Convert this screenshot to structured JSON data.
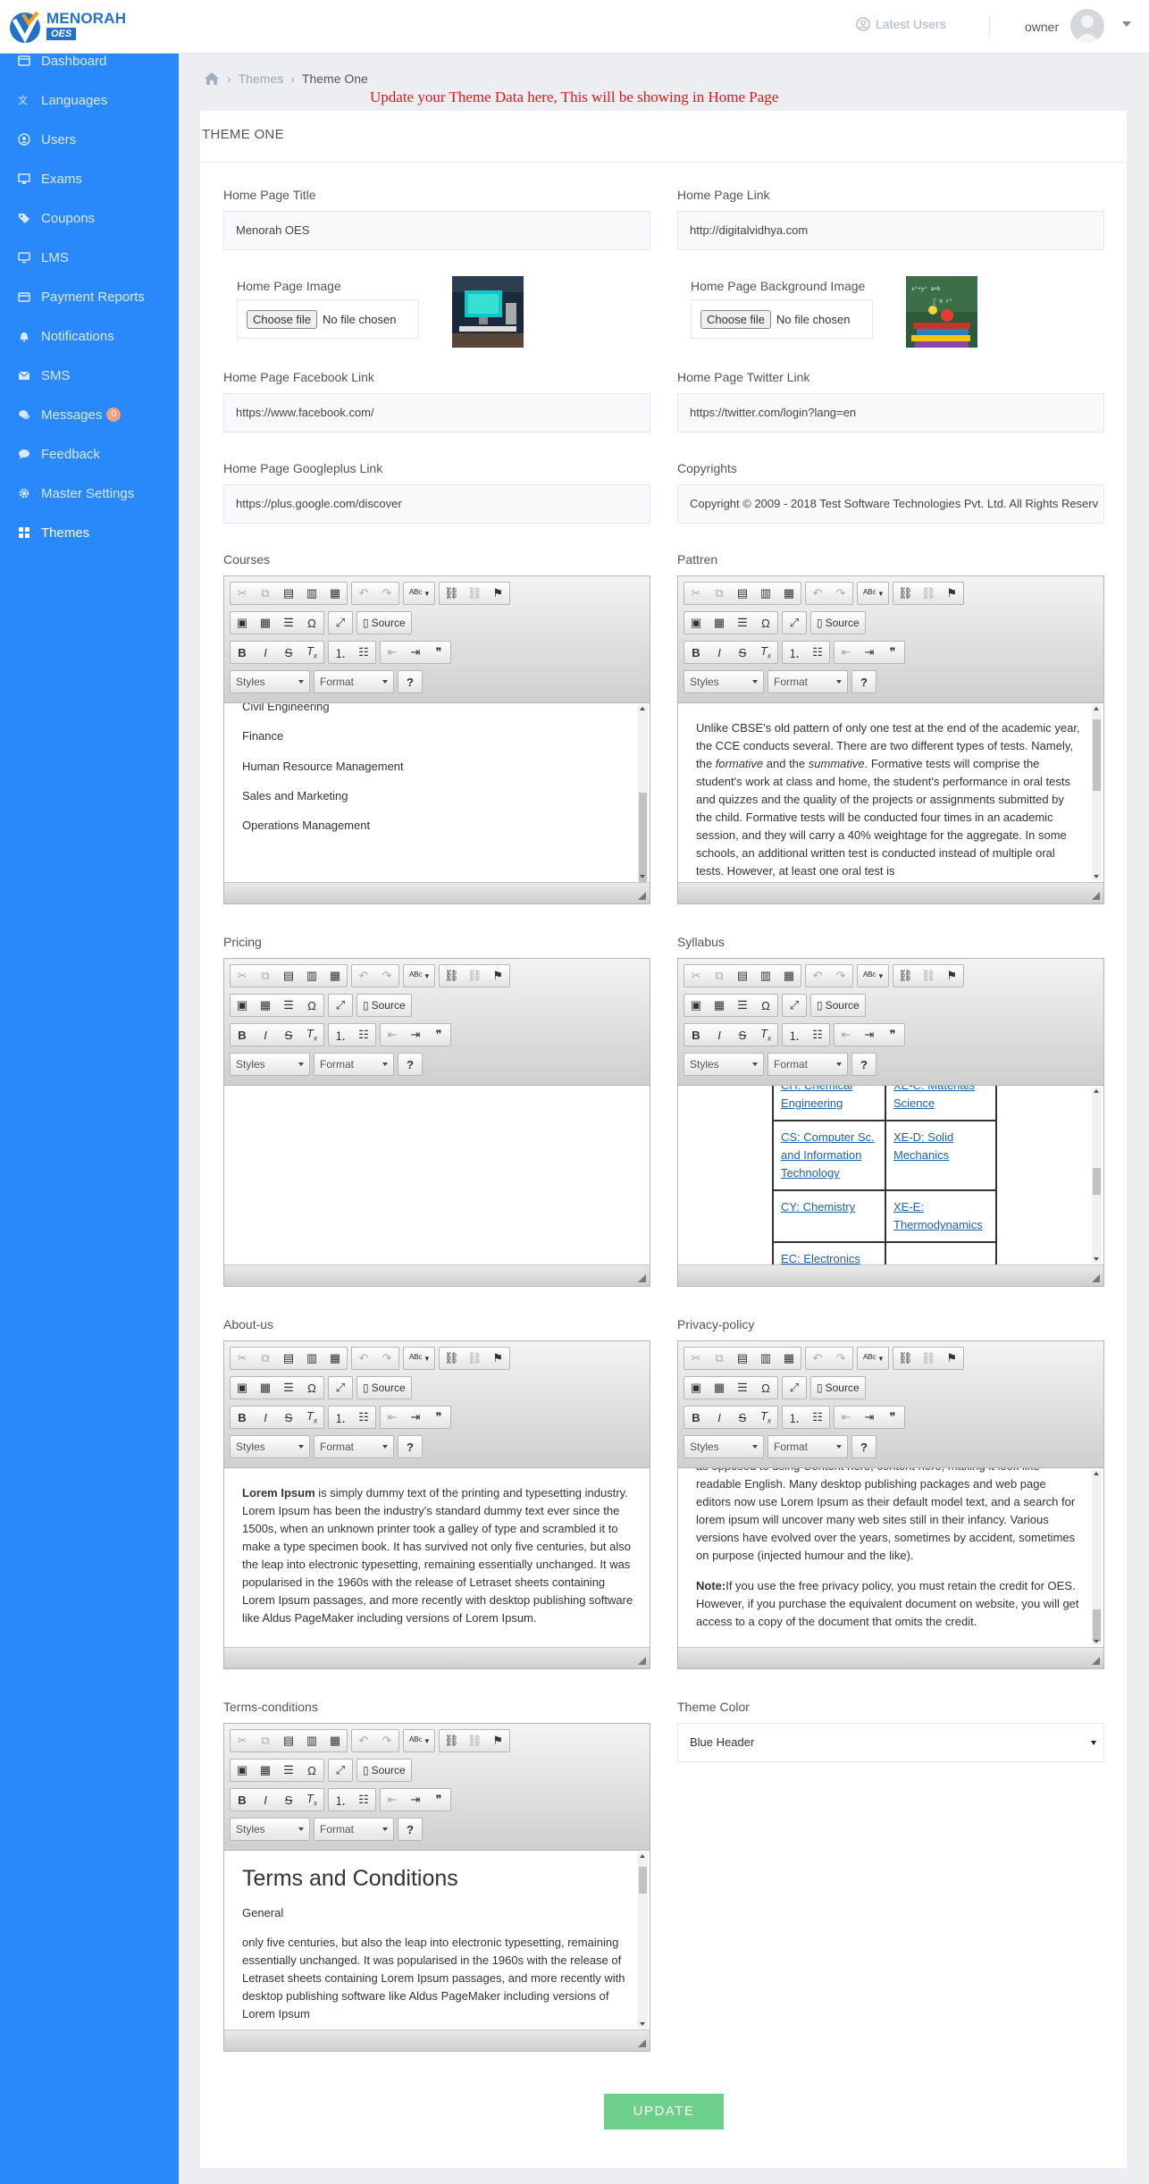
{
  "header": {
    "brand_name": "MENORAH",
    "brand_sub": "OES",
    "latest_users": "Latest Users",
    "user_name": "owner"
  },
  "sidebar": {
    "items": [
      {
        "label": "Dashboard",
        "icon": "dashboard-icon"
      },
      {
        "label": "Languages",
        "icon": "language-icon"
      },
      {
        "label": "Users",
        "icon": "user-icon"
      },
      {
        "label": "Exams",
        "icon": "desktop-icon"
      },
      {
        "label": "Coupons",
        "icon": "tags-icon"
      },
      {
        "label": "LMS",
        "icon": "monitor-icon"
      },
      {
        "label": "Payment Reports",
        "icon": "credit-card-icon"
      },
      {
        "label": "Notifications",
        "icon": "bell-icon"
      },
      {
        "label": "SMS",
        "icon": "envelope-icon"
      },
      {
        "label": "Messages",
        "icon": "comments-icon",
        "badge": "0"
      },
      {
        "label": "Feedback",
        "icon": "comment-icon"
      },
      {
        "label": "Master Settings",
        "icon": "gear-icon"
      },
      {
        "label": "Themes",
        "icon": "grid-icon",
        "active": true
      }
    ]
  },
  "breadcrumb": {
    "items": [
      "Themes",
      "Theme One"
    ]
  },
  "notice": "Update your Theme Data here, This will be showing in Home Page",
  "card": {
    "title": "THEME ONE"
  },
  "form": {
    "home_page_title": {
      "label": "Home Page Title",
      "value": "Menorah OES"
    },
    "home_page_link": {
      "label": "Home Page Link",
      "value": "http://digitalvidhya.com"
    },
    "home_page_image": {
      "label": "Home Page Image",
      "button": "Choose file",
      "status": "No file chosen"
    },
    "home_page_bg_image": {
      "label": "Home Page Background Image",
      "button": "Choose file",
      "status": "No file chosen"
    },
    "facebook": {
      "label": "Home Page Facebook Link",
      "value": "https://www.facebook.com/"
    },
    "twitter": {
      "label": "Home Page Twitter Link",
      "value": "https://twitter.com/login?lang=en"
    },
    "googleplus": {
      "label": "Home Page Googleplus Link",
      "value": "https://plus.google.com/discover"
    },
    "copyrights": {
      "label": "Copyrights",
      "value": "Copyright © 2009 - 2018  Test Software Technologies Pvt. Ltd. All Rights Reserv"
    },
    "theme_color": {
      "label": "Theme Color",
      "value": "Blue Header"
    }
  },
  "editor_toolbar": {
    "source": "Source",
    "styles": "Styles",
    "format": "Format",
    "help": "?"
  },
  "editors": {
    "courses": {
      "label": "Courses",
      "items": [
        "Civil Engineering",
        "Finance",
        "Human Resource Management",
        "Sales and Marketing",
        "Operations Management"
      ]
    },
    "pattren": {
      "label": "Pattren",
      "p1": "Unlike CBSE's old pattern of only one test at the end of the academic year, the CCE conducts several. There are two different types of tests. Namely, the ",
      "p1_em1": "formative",
      "p1_mid": " and the ",
      "p1_em2": "summative",
      "p1_end": ". Formative tests will comprise the student's work at class and home, the student's performance in oral tests and quizzes and the quality of the projects or assignments submitted by the child. Formative tests will be conducted four times in an academic session, and they will carry a 40% weightage for the aggregate. In some schools, an additional written test is conducted instead of multiple oral tests. However, at least one oral test is"
    },
    "pricing": {
      "label": "Pricing"
    },
    "syllabus": {
      "label": "Syllabus",
      "rows": [
        [
          "CH: Chemical Engineering",
          "XE-C: Materials Science"
        ],
        [
          "CS: Computer Sc. and Information Technology",
          "XE-D: Solid Mechanics"
        ],
        [
          "CY: Chemistry",
          "XE-E: Thermodynamics"
        ],
        [
          "EC: Electronics",
          ""
        ]
      ]
    },
    "about": {
      "label": "About-us",
      "bold": "Lorem Ipsum",
      "text": " is simply dummy text of the printing and typesetting industry. Lorem Ipsum has been the industry's standard dummy text ever since the 1500s, when an unknown printer took a galley of type and scrambled it to make a type specimen book. It has survived not only five centuries, but also the leap into electronic typesetting, remaining essentially unchanged. It was popularised in the 1960s with the release of Letraset sheets containing Lorem Ipsum passages, and more recently with desktop publishing software like Aldus PageMaker including versions of Lorem Ipsum."
    },
    "privacy": {
      "label": "Privacy-policy",
      "text": "as opposed to using Content here, content here, making it look like readable English. Many desktop publishing packages and web page editors now use Lorem Ipsum as their default model text, and a search for lorem ipsum will uncover many web sites still in their infancy. Various versions have evolved over the years, sometimes by accident, sometimes on purpose (injected humour and the like).",
      "note_bold": "Note:",
      "note_text": "If you use the free privacy policy, you must retain the credit for OES. However, if you purchase the equivalent document on website, you will get access to a copy of the document that omits the credit."
    },
    "terms": {
      "label": "Terms-conditions",
      "heading": "Terms and Conditions",
      "sub": "General",
      "text": "only five centuries, but also the leap into electronic typesetting, remaining essentially unchanged. It was popularised in the 1960s with the release of Letraset sheets containing Lorem Ipsum passages, and more recently with desktop publishing software like Aldus PageMaker including versions of Lorem Ipsum"
    }
  },
  "update_button": "UPDATE",
  "colors": {
    "sidebar": "#2a89fa",
    "brand": "#2471c8",
    "notice": "#e8141b",
    "update": "#6dd08a"
  }
}
